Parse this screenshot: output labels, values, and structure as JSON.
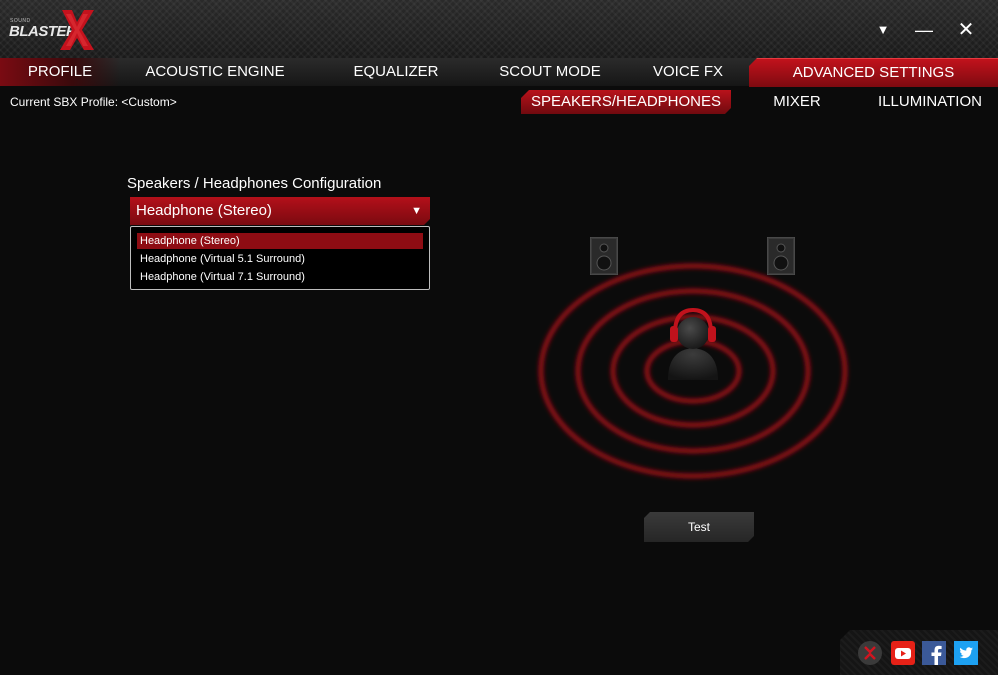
{
  "app": {
    "logo_small": "SOUND",
    "logo_main": "BLASTER",
    "window_controls": {
      "menu_icon": "triangle-down-icon",
      "minimize": "—",
      "close": "✕"
    }
  },
  "tabs": [
    {
      "label": "PROFILE"
    },
    {
      "label": "ACOUSTIC ENGINE"
    },
    {
      "label": "EQUALIZER"
    },
    {
      "label": "SCOUT MODE"
    },
    {
      "label": "VOICE FX"
    },
    {
      "label": "ADVANCED SETTINGS",
      "active": true
    }
  ],
  "profile_line": "Current SBX Profile: <Custom>",
  "subtabs": [
    {
      "label": "SPEAKERS/HEADPHONES",
      "active": true
    },
    {
      "label": "MIXER"
    },
    {
      "label": "ILLUMINATION"
    }
  ],
  "config": {
    "label": "Speakers / Headphones Configuration",
    "selected": "Headphone (Stereo)",
    "options": [
      {
        "label": "Headphone (Stereo)",
        "selected": true
      },
      {
        "label": "Headphone (Virtual 5.1 Surround)"
      },
      {
        "label": "Headphone (Virtual 7.1 Surround)"
      }
    ]
  },
  "test_button": "Test",
  "social": {
    "icons": [
      "soundblaster-x-icon",
      "youtube-icon",
      "facebook-icon",
      "twitter-icon"
    ]
  },
  "colors": {
    "accent": "#b4101a",
    "background": "#0b0b0b"
  }
}
